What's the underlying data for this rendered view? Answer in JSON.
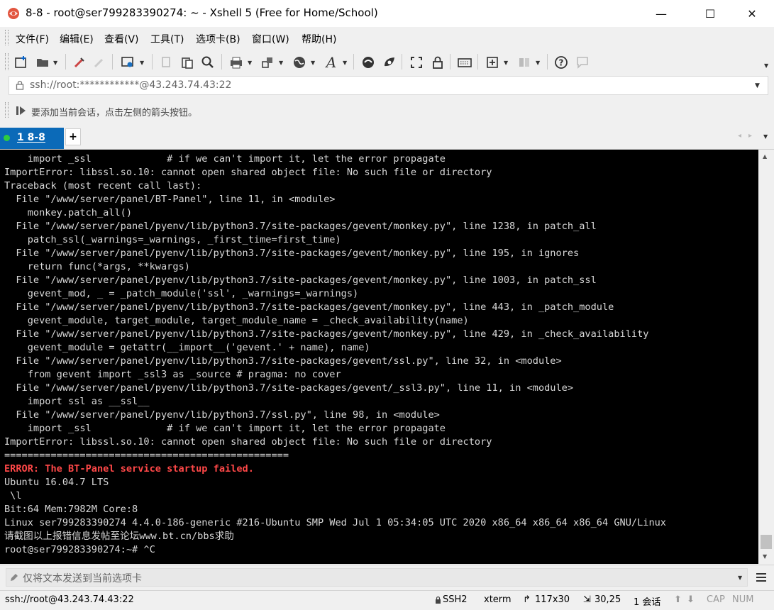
{
  "window": {
    "title": "8-8 - root@ser799283390274: ~ - Xshell 5 (Free for Home/School)",
    "minimize": "—",
    "maximize": "☐",
    "close": "✕"
  },
  "menu": {
    "items": [
      "文件(F)",
      "编辑(E)",
      "查看(V)",
      "工具(T)",
      "选项卡(B)",
      "窗口(W)",
      "帮助(H)"
    ]
  },
  "toolbar": {
    "icons": [
      "new-session-icon",
      "open-folder-icon",
      "reconnect-icon",
      "disconnect-icon",
      "properties-icon",
      "copy-icon",
      "paste-icon",
      "find-icon",
      "print-icon",
      "transfer-icon",
      "globe-icon",
      "font-icon",
      "xftp-icon",
      "xagent-icon",
      "fullscreen-icon",
      "lock-icon",
      "keyboard-icon",
      "add-compose-icon",
      "layout-icon",
      "help-icon",
      "chat-icon"
    ]
  },
  "address": {
    "lock_icon": "lock-icon",
    "value": "ssh://root:************@43.243.74.43:22"
  },
  "hint": {
    "text": "要添加当前会话，点击左侧的箭头按钮。"
  },
  "tabs": [
    {
      "label": "1 8-8",
      "status_color": "#2ecc40",
      "active": true
    }
  ],
  "tab_add": "+",
  "terminal": {
    "lines_before_error": [
      "    import _ssl             # if we can't import it, let the error propagate",
      "ImportError: libssl.so.10: cannot open shared object file: No such file or directory",
      "Traceback (most recent call last):",
      "  File \"/www/server/panel/BT-Panel\", line 11, in <module>",
      "    monkey.patch_all()",
      "  File \"/www/server/panel/pyenv/lib/python3.7/site-packages/gevent/monkey.py\", line 1238, in patch_all",
      "    patch_ssl(_warnings=_warnings, _first_time=first_time)",
      "  File \"/www/server/panel/pyenv/lib/python3.7/site-packages/gevent/monkey.py\", line 195, in ignores",
      "    return func(*args, **kwargs)",
      "  File \"/www/server/panel/pyenv/lib/python3.7/site-packages/gevent/monkey.py\", line 1003, in patch_ssl",
      "    gevent_mod, _ = _patch_module('ssl', _warnings=_warnings)",
      "  File \"/www/server/panel/pyenv/lib/python3.7/site-packages/gevent/monkey.py\", line 443, in _patch_module",
      "    gevent_module, target_module, target_module_name = _check_availability(name)",
      "  File \"/www/server/panel/pyenv/lib/python3.7/site-packages/gevent/monkey.py\", line 429, in _check_availability",
      "    gevent_module = getattr(__import__('gevent.' + name), name)",
      "  File \"/www/server/panel/pyenv/lib/python3.7/site-packages/gevent/ssl.py\", line 32, in <module>",
      "    from gevent import _ssl3 as _source # pragma: no cover",
      "  File \"/www/server/panel/pyenv/lib/python3.7/site-packages/gevent/_ssl3.py\", line 11, in <module>",
      "    import ssl as __ssl__",
      "  File \"/www/server/panel/pyenv/lib/python3.7/ssl.py\", line 98, in <module>",
      "    import _ssl             # if we can't import it, let the error propagate",
      "ImportError: libssl.so.10: cannot open shared object file: No such file or directory",
      "================================================="
    ],
    "error_line": "ERROR: The BT-Panel service startup failed.",
    "lines_after_error": [
      "Ubuntu 16.04.7 LTS",
      " \\l",
      "Bit:64 Mem:7982M Core:8",
      "Linux ser799283390274 4.4.0-186-generic #216-Ubuntu SMP Wed Jul 1 05:34:05 UTC 2020 x86_64 x86_64 x86_64 GNU/Linux",
      "请截图以上报错信息发帖至论坛www.bt.cn/bbs求助",
      "root@ser799283390274:~# ^C"
    ]
  },
  "compose": {
    "placeholder": "仅将文本发送到当前选项卡"
  },
  "status": {
    "connection": "ssh://root@43.243.74.43:22",
    "protocol": "SSH2",
    "terminal_type": "xterm",
    "size": "117x30",
    "cursor": "30,25",
    "sessions": "1 会话",
    "cap": "CAP",
    "num": "NUM"
  }
}
